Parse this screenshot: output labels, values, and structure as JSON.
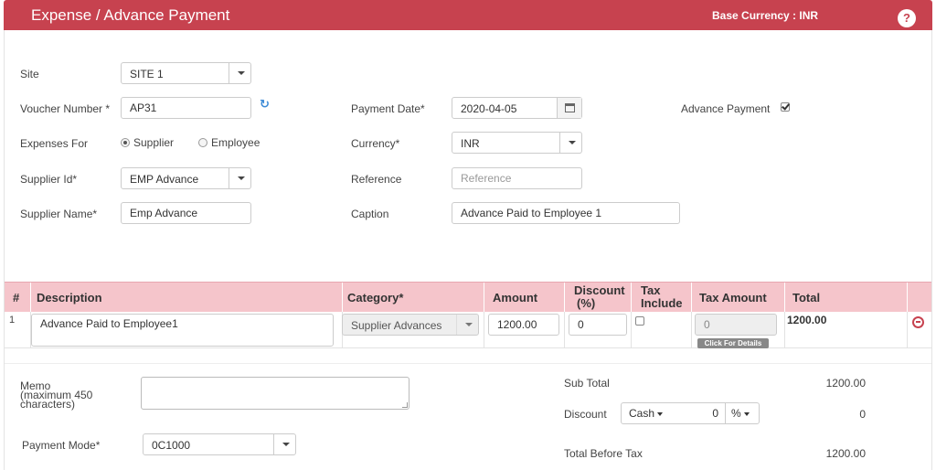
{
  "header": {
    "title": "Expense / Advance Payment",
    "base_currency": "Base Currency :  INR",
    "help": "?"
  },
  "form": {
    "site_label": "Site",
    "site_value": "SITE 1",
    "voucher_label": "Voucher Number *",
    "voucher_value": "AP31",
    "expenses_for_label": "Expenses For",
    "supplier_option": "Supplier",
    "employee_option": "Employee",
    "supplier_id_label": "Supplier Id*",
    "supplier_id_value": "EMP Advance",
    "supplier_name_label": "Supplier Name*",
    "supplier_name_value": "Emp Advance",
    "payment_date_label": "Payment Date*",
    "payment_date_value": "2020-04-05",
    "currency_label": "Currency*",
    "currency_value": "INR",
    "reference_label": "Reference",
    "reference_placeholder": "Reference",
    "caption_label": "Caption",
    "caption_value": "Advance Paid to Employee 1",
    "advance_payment_label": "Advance Payment"
  },
  "table": {
    "headers": {
      "num": "#",
      "description": "Description",
      "category": "Category*",
      "amount": "Amount",
      "discount_line1": "Discount",
      "discount_line2": "(%)",
      "tax_line1": "Tax",
      "tax_line2": "Include",
      "tax_amount": "Tax Amount",
      "total": "Total"
    },
    "rows": [
      {
        "num": "1",
        "description": "Advance Paid to Employee1",
        "category": "Supplier Advances",
        "amount": "1200.00",
        "discount": "0",
        "tax_amount": "0",
        "details_label": "Click For Details",
        "total": "1200.00"
      }
    ]
  },
  "footer": {
    "memo_label_1": "Memo",
    "memo_label_2": "(maximum 450",
    "memo_label_3": "characters)",
    "payment_mode_label": "Payment Mode*",
    "payment_mode_value": "0C1000",
    "subtotal_label": "Sub Total",
    "subtotal_value": "1200.00",
    "discount_label": "Discount",
    "discount_type": "Cash",
    "discount_amount": "0",
    "discount_unit": "%",
    "discount_value": "0",
    "total_before_tax_label": "Total Before Tax",
    "total_before_tax_value": "1200.00"
  },
  "colors": {
    "brand": "#c7424f",
    "table_header": "#f5c5cb",
    "link_icon": "#3d8bd6"
  },
  "icons": {
    "help": "question-circle-icon",
    "refresh": "refresh-icon",
    "calendar": "calendar-icon",
    "remove": "minus-circle-icon"
  }
}
